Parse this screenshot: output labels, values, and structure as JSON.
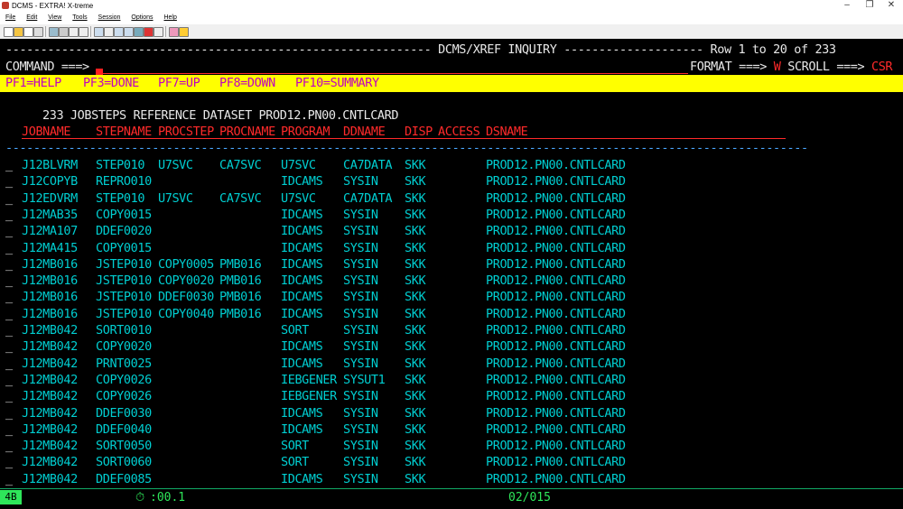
{
  "window": {
    "title": "DCMS - EXTRA! X-treme",
    "minimize": "–",
    "maximize": "❐",
    "close": "✕"
  },
  "menu": [
    "File",
    "Edit",
    "View",
    "Tools",
    "Session",
    "Options",
    "Help"
  ],
  "screen": {
    "header_dashes_left": "-------------------------------------------------------------",
    "title": "DCMS/XREF INQUIRY",
    "header_dashes_right": "--------------------",
    "row_indicator": "Row 1 to 20 of 233",
    "command_label": "COMMAND ===>",
    "format_label": "FORMAT ===>",
    "format_value": "W",
    "scroll_label": "SCROLL ===>",
    "scroll_value": "CSR",
    "pf_keys": [
      "PF1=HELP",
      "PF3=DONE",
      "PF7=UP",
      "PF8=DOWN",
      "PF10=SUMMARY"
    ],
    "summary": "233 JOBSTEPS REFERENCE DATASET PROD12.PN00.CNTLCARD",
    "columns": [
      "JOBNAME",
      "STEPNAME",
      "PROCSTEP",
      "PROCNAME",
      "PROGRAM",
      "DDNAME",
      "DISP",
      "ACCESS",
      "DSNAME"
    ],
    "separator": "-------------------------------------------------------------------------------------------------------------------",
    "rows": [
      {
        "sel": "_",
        "jobname": "J12BLVRM",
        "stepname": "STEP010",
        "procstep": "U7SVC",
        "procname": "CA7SVC",
        "program": "U7SVC",
        "ddname": "CA7DATA",
        "disp": "SKK",
        "access": "",
        "dsname": "PROD12.PN00.CNTLCARD"
      },
      {
        "sel": "_",
        "jobname": "J12COPYB",
        "stepname": "REPRO010",
        "procstep": "",
        "procname": "",
        "program": "IDCAMS",
        "ddname": "SYSIN",
        "disp": "SKK",
        "access": "",
        "dsname": "PROD12.PN00.CNTLCARD"
      },
      {
        "sel": "_",
        "jobname": "J12EDVRM",
        "stepname": "STEP010",
        "procstep": "U7SVC",
        "procname": "CA7SVC",
        "program": "U7SVC",
        "ddname": "CA7DATA",
        "disp": "SKK",
        "access": "",
        "dsname": "PROD12.PN00.CNTLCARD"
      },
      {
        "sel": "_",
        "jobname": "J12MAB35",
        "stepname": "COPY0015",
        "procstep": "",
        "procname": "",
        "program": "IDCAMS",
        "ddname": "SYSIN",
        "disp": "SKK",
        "access": "",
        "dsname": "PROD12.PN00.CNTLCARD"
      },
      {
        "sel": "_",
        "jobname": "J12MA107",
        "stepname": "DDEF0020",
        "procstep": "",
        "procname": "",
        "program": "IDCAMS",
        "ddname": "SYSIN",
        "disp": "SKK",
        "access": "",
        "dsname": "PROD12.PN00.CNTLCARD"
      },
      {
        "sel": "_",
        "jobname": "J12MA415",
        "stepname": "COPY0015",
        "procstep": "",
        "procname": "",
        "program": "IDCAMS",
        "ddname": "SYSIN",
        "disp": "SKK",
        "access": "",
        "dsname": "PROD12.PN00.CNTLCARD"
      },
      {
        "sel": "_",
        "jobname": "J12MB016",
        "stepname": "JSTEP010",
        "procstep": "COPY0005",
        "procname": "PMB016",
        "program": "IDCAMS",
        "ddname": "SYSIN",
        "disp": "SKK",
        "access": "",
        "dsname": "PROD12.PN00.CNTLCARD"
      },
      {
        "sel": "_",
        "jobname": "J12MB016",
        "stepname": "JSTEP010",
        "procstep": "COPY0020",
        "procname": "PMB016",
        "program": "IDCAMS",
        "ddname": "SYSIN",
        "disp": "SKK",
        "access": "",
        "dsname": "PROD12.PN00.CNTLCARD"
      },
      {
        "sel": "_",
        "jobname": "J12MB016",
        "stepname": "JSTEP010",
        "procstep": "DDEF0030",
        "procname": "PMB016",
        "program": "IDCAMS",
        "ddname": "SYSIN",
        "disp": "SKK",
        "access": "",
        "dsname": "PROD12.PN00.CNTLCARD"
      },
      {
        "sel": "_",
        "jobname": "J12MB016",
        "stepname": "JSTEP010",
        "procstep": "COPY0040",
        "procname": "PMB016",
        "program": "IDCAMS",
        "ddname": "SYSIN",
        "disp": "SKK",
        "access": "",
        "dsname": "PROD12.PN00.CNTLCARD"
      },
      {
        "sel": "_",
        "jobname": "J12MB042",
        "stepname": "SORT0010",
        "procstep": "",
        "procname": "",
        "program": "SORT",
        "ddname": "SYSIN",
        "disp": "SKK",
        "access": "",
        "dsname": "PROD12.PN00.CNTLCARD"
      },
      {
        "sel": "_",
        "jobname": "J12MB042",
        "stepname": "COPY0020",
        "procstep": "",
        "procname": "",
        "program": "IDCAMS",
        "ddname": "SYSIN",
        "disp": "SKK",
        "access": "",
        "dsname": "PROD12.PN00.CNTLCARD"
      },
      {
        "sel": "_",
        "jobname": "J12MB042",
        "stepname": "PRNT0025",
        "procstep": "",
        "procname": "",
        "program": "IDCAMS",
        "ddname": "SYSIN",
        "disp": "SKK",
        "access": "",
        "dsname": "PROD12.PN00.CNTLCARD"
      },
      {
        "sel": "_",
        "jobname": "J12MB042",
        "stepname": "COPY0026",
        "procstep": "",
        "procname": "",
        "program": "IEBGENER",
        "ddname": "SYSUT1",
        "disp": "SKK",
        "access": "",
        "dsname": "PROD12.PN00.CNTLCARD"
      },
      {
        "sel": "_",
        "jobname": "J12MB042",
        "stepname": "COPY0026",
        "procstep": "",
        "procname": "",
        "program": "IEBGENER",
        "ddname": "SYSIN",
        "disp": "SKK",
        "access": "",
        "dsname": "PROD12.PN00.CNTLCARD"
      },
      {
        "sel": "_",
        "jobname": "J12MB042",
        "stepname": "DDEF0030",
        "procstep": "",
        "procname": "",
        "program": "IDCAMS",
        "ddname": "SYSIN",
        "disp": "SKK",
        "access": "",
        "dsname": "PROD12.PN00.CNTLCARD"
      },
      {
        "sel": "_",
        "jobname": "J12MB042",
        "stepname": "DDEF0040",
        "procstep": "",
        "procname": "",
        "program": "IDCAMS",
        "ddname": "SYSIN",
        "disp": "SKK",
        "access": "",
        "dsname": "PROD12.PN00.CNTLCARD"
      },
      {
        "sel": "_",
        "jobname": "J12MB042",
        "stepname": "SORT0050",
        "procstep": "",
        "procname": "",
        "program": "SORT",
        "ddname": "SYSIN",
        "disp": "SKK",
        "access": "",
        "dsname": "PROD12.PN00.CNTLCARD"
      },
      {
        "sel": "_",
        "jobname": "J12MB042",
        "stepname": "SORT0060",
        "procstep": "",
        "procname": "",
        "program": "SORT",
        "ddname": "SYSIN",
        "disp": "SKK",
        "access": "",
        "dsname": "PROD12.PN00.CNTLCARD"
      },
      {
        "sel": "_",
        "jobname": "J12MB042",
        "stepname": "DDEF0085",
        "procstep": "",
        "procname": "",
        "program": "IDCAMS",
        "ddname": "SYSIN",
        "disp": "SKK",
        "access": "",
        "dsname": "PROD12.PN00.CNTLCARD"
      }
    ]
  },
  "status": {
    "session": "4B",
    "timer": ":00.1",
    "cursor_pos": "02/015"
  },
  "colors": {
    "pf_bar": "#ffff00",
    "pf_text": "#c000c0",
    "data_text": "#00ced1",
    "header_red": "#ff2a2a",
    "status_green": "#2ee65a"
  }
}
